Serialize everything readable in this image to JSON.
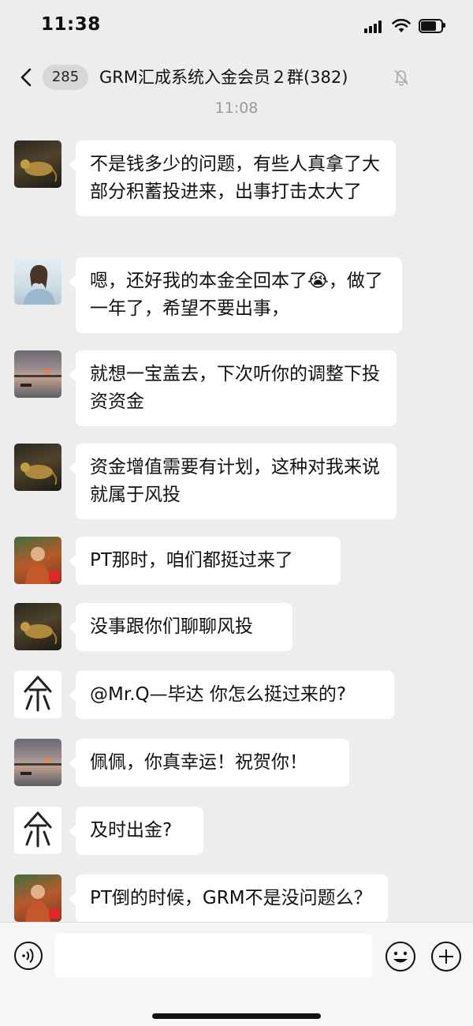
{
  "status_bar": {
    "time": "11:38"
  },
  "nav": {
    "unread_count": "285",
    "title": "GRM汇成系统入金会员２群(382)"
  },
  "chat": {
    "timestamp": "11:08",
    "messages": [
      {
        "avatar": "bronze-rat-avatar",
        "text": "不是钱多少的问题，有些人真拿了大部分积蓄投进来，出事打击太大了"
      },
      {
        "avatar": "woman-avatar",
        "text": "嗯，还好我的本金全回本了😭，做了一年了，希望不要出事，"
      },
      {
        "avatar": "sunset-avatar",
        "text": "就想一宝盖去，下次听你的调整下投资资金"
      },
      {
        "avatar": "bronze-rat-avatar",
        "text": "资金增值需要有计划，这种对我来说就属于风投"
      },
      {
        "avatar": "monk-avatar",
        "text": "PT那时，咱们都挺过来了"
      },
      {
        "avatar": "bronze-rat-avatar",
        "text": "没事跟你们聊聊风投"
      },
      {
        "avatar": "glyph-avatar",
        "text": "@Mr.Q—毕达 你怎么挺过来的?"
      },
      {
        "avatar": "sunset-avatar",
        "text": "佩佩，你真幸运！祝贺你！"
      },
      {
        "avatar": "glyph-avatar",
        "text": "及时出金?"
      },
      {
        "avatar": "monk-avatar",
        "text": "PT倒的时候，GRM不是没问题么？"
      }
    ]
  },
  "input_bar": {
    "message_value": ""
  },
  "colors": {
    "background": "#ededed",
    "bubble": "#ffffff",
    "badge": "#d7d7d7"
  }
}
